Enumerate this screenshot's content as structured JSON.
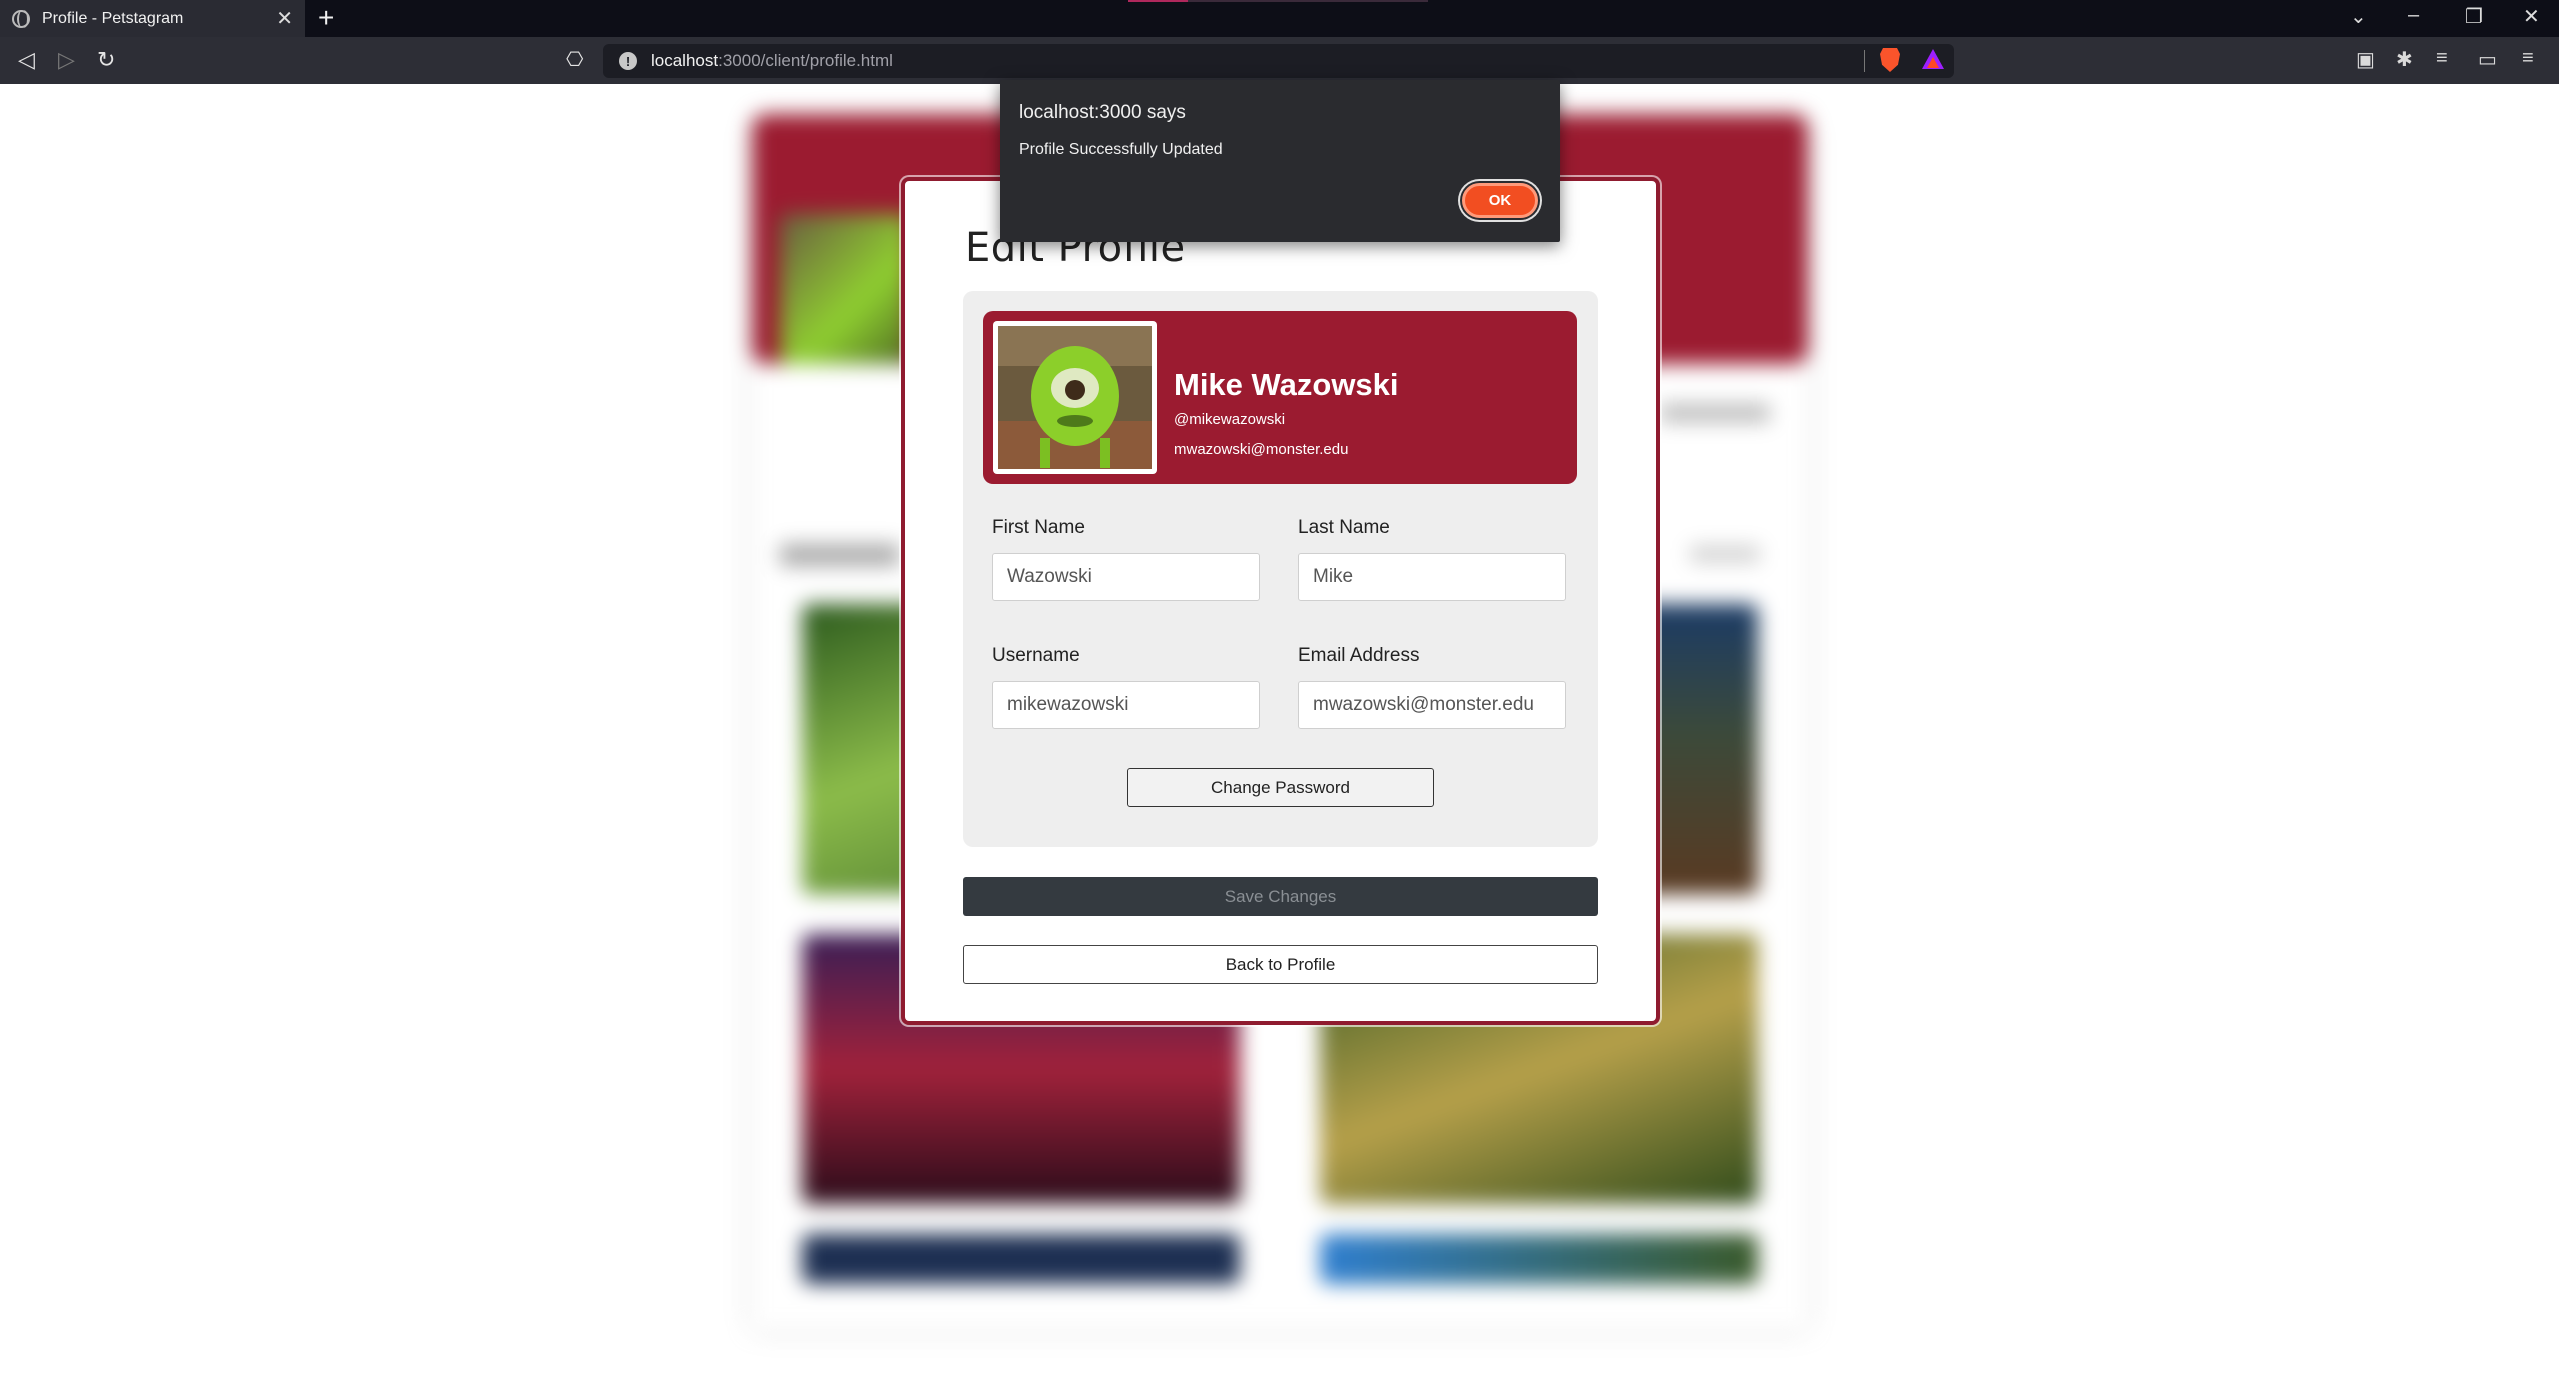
{
  "browser": {
    "tab_title": "Profile - Petstagram",
    "tab_close": "✕",
    "new_tab": "+",
    "url_host": "localhost",
    "url_path": ":3000/client/profile.html",
    "info_icon": "!",
    "window_controls": {
      "dropdown": "⌄",
      "minimize": "–",
      "restore": "❐",
      "close": "✕"
    },
    "nav": {
      "back": "◁",
      "forward": "▷",
      "reload": "↻",
      "bookmark": "⎔"
    },
    "tools": {
      "ext": "▣",
      "puzzle": "✱",
      "playlist": "≡",
      "wallet": "▭",
      "menu": "≡"
    }
  },
  "alert": {
    "title": "localhost:3000 says",
    "message": "Profile Successfully Updated",
    "ok_label": "OK"
  },
  "modal": {
    "title": "Edit Profile",
    "profile": {
      "name": "Mike Wazowski",
      "handle": "@mikewazowski",
      "email": "mwazowski@monster.edu"
    },
    "fields": {
      "first_name_label": "First Name",
      "first_name_value": "Wazowski",
      "last_name_label": "Last Name",
      "last_name_value": "Mike",
      "username_label": "Username",
      "username_value": "mikewazowski",
      "email_label": "Email Address",
      "email_value": "mwazowski@monster.edu"
    },
    "change_password_label": "Change Password",
    "save_label": "Save Changes",
    "back_label": "Back to Profile"
  },
  "colors": {
    "accent": "#9b1b30",
    "alert_ok": "#f24e21",
    "save_button": "#343a40"
  }
}
